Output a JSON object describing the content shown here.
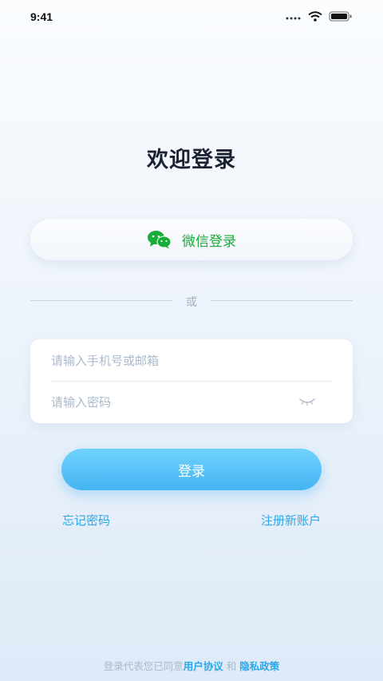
{
  "status_bar": {
    "time": "9:41"
  },
  "page": {
    "title": "欢迎登录"
  },
  "wechat_login": {
    "label": "微信登录",
    "brand_color": "#19ad3a"
  },
  "divider": {
    "text": "或"
  },
  "form": {
    "phone_placeholder": "请输入手机号或邮箱",
    "password_placeholder": "请输入密码"
  },
  "login_button": {
    "label": "登录",
    "accent": "#45b4f4"
  },
  "links": {
    "forgot_password": "忘记密码",
    "register": "注册新账户"
  },
  "agreement": {
    "prefix": "登录代表您已同意",
    "user_agreement": "用户协议",
    "conjunction": "和",
    "privacy_policy": "隐私政策"
  },
  "icons": [
    "cellular-icon",
    "wifi-icon",
    "battery-icon",
    "wechat-icon",
    "eye-closed-icon"
  ]
}
